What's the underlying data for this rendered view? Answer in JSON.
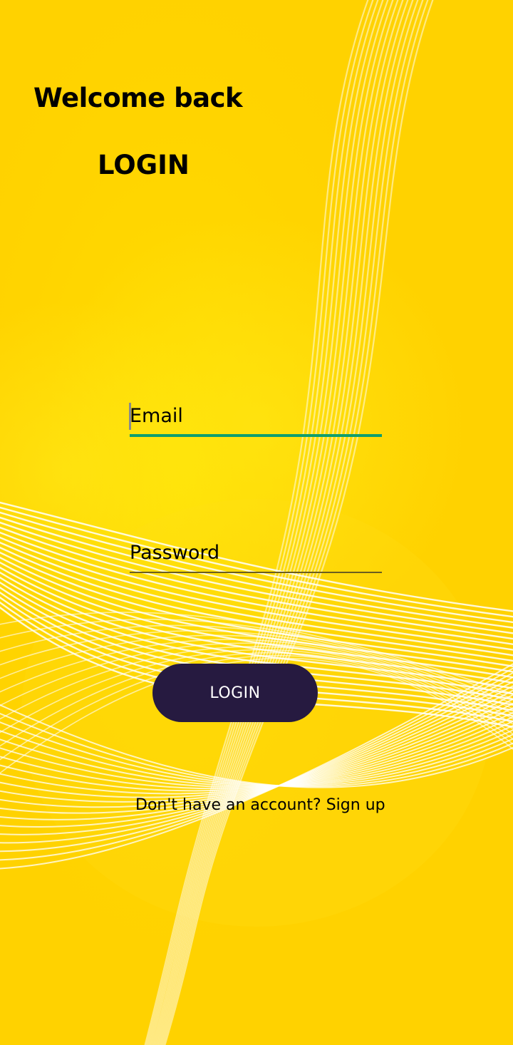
{
  "header": {
    "welcome": "Welcome back",
    "title": "LOGIN"
  },
  "form": {
    "email_placeholder": "Email",
    "password_placeholder": "Password",
    "submit_label": "LOGIN",
    "signup_text": "Don't have an account? Sign up"
  },
  "colors": {
    "background": "#FFD200",
    "button": "#261A40",
    "active_underline": "#0E9F6E"
  }
}
